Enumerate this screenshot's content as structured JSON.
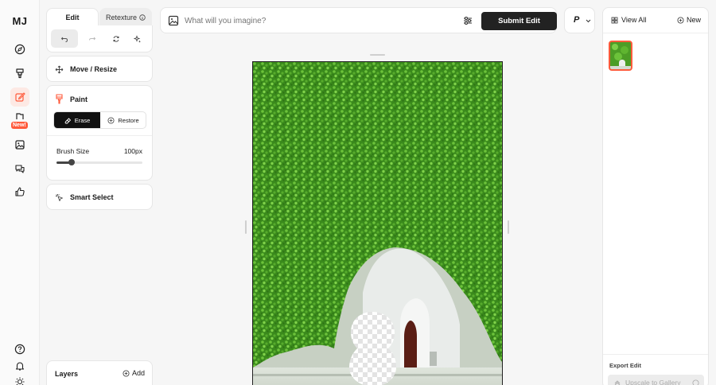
{
  "nav": {
    "logo": "MJ",
    "new_badge": "New!"
  },
  "tabs": {
    "edit": "Edit",
    "retexture": "Retexture"
  },
  "tools": {
    "move_resize": "Move / Resize",
    "paint": "Paint",
    "erase": "Erase",
    "restore": "Restore",
    "brush_size_label": "Brush Size",
    "brush_size_value": "100px",
    "brush_size_fraction": 0.18,
    "smart_select": "Smart Select",
    "layers": "Layers",
    "add": "Add"
  },
  "prompt": {
    "placeholder": "What will you imagine?",
    "submit": "Submit Edit",
    "personalize_label": "P"
  },
  "right": {
    "view_all": "View All",
    "new": "New",
    "export_edit": "Export Edit",
    "upscale": "Upscale to Gallery"
  },
  "colors": {
    "accent": "#ff5b3c",
    "dark": "#222222",
    "foliage": "#3f8f1f"
  }
}
